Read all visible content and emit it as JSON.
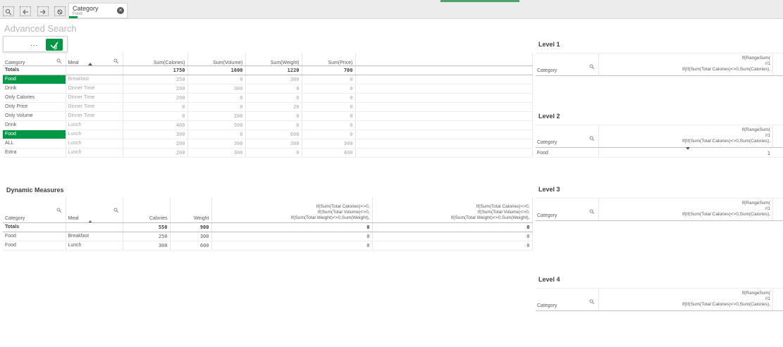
{
  "toolbar": {
    "tools": [
      "smart-search-icon",
      "step-back-icon",
      "step-forward-icon",
      "clear-selections-icon"
    ],
    "selection_chip": {
      "field": "Category",
      "value": "Food"
    }
  },
  "sheet_title": "Advanced Search",
  "search_popup": {
    "dots": "..."
  },
  "main_table": {
    "headers": [
      "Category",
      "Meal",
      "Sum(Calories)",
      "Sum(Volume)",
      "Sum(Weight)",
      "Sum(Price)"
    ],
    "totals": [
      "Totals",
      "",
      "1750",
      "1600",
      "1220",
      "700"
    ],
    "rows": [
      [
        "Food",
        "Breakfast",
        "250",
        "0",
        "300",
        "0"
      ],
      [
        "Drink",
        "Dinner Time",
        "200",
        "300",
        "0",
        "0"
      ],
      [
        "Only Calories",
        "Dinner Time",
        "200",
        "0",
        "0",
        "0"
      ],
      [
        "Only Price",
        "Dinner Time",
        "0",
        "0",
        "20",
        "0"
      ],
      [
        "Only Volume",
        "Dinner Time",
        "0",
        "200",
        "0",
        "0"
      ],
      [
        "Drink",
        "Lunch",
        "400",
        "500",
        "0",
        "0"
      ],
      [
        "Food",
        "Lunch",
        "300",
        "0",
        "600",
        "0"
      ],
      [
        "ALL",
        "Lunch",
        "200",
        "300",
        "300",
        "300"
      ],
      [
        "Extra",
        "Lunch",
        "200",
        "300",
        "0",
        "400"
      ]
    ]
  },
  "dynamic_measures": {
    "title": "Dynamic Measures",
    "headers": [
      "Category",
      "Meal",
      "Calories",
      "Weight"
    ],
    "expr_col1": [
      "If(Sum(Total Calories)<>0,",
      "If(Sum(Total Volume)<>0,",
      "If(Sum(Total Weight)<>0,Sum(Weight),"
    ],
    "expr_col2": [
      "If(Sum(Total Calories)<>0,",
      "If(Sum(Total Volume)<>0,",
      "If(Sum(Total Weight)<>0,Sum(Weight),"
    ],
    "totals": [
      "Totals",
      "",
      "550",
      "900",
      "0",
      "0"
    ],
    "rows": [
      [
        "Food",
        "Breakfast",
        "250",
        "300",
        "0",
        "0"
      ],
      [
        "Food",
        "Lunch",
        "300",
        "600",
        "0",
        "0"
      ]
    ]
  },
  "levels": [
    {
      "title": "Level 1",
      "category": "Category",
      "expr": [
        "If(RangeSum(",
        "//1",
        "If(If(Sum(Total Calories)<>0,Sum(Calories),"
      ],
      "rows": []
    },
    {
      "title": "Level 2",
      "category": "Category",
      "expr": [
        "If(RangeSum(",
        "//1",
        "If(If(Sum(Total Calories)<>0,Sum(Calories),"
      ],
      "rows": [
        [
          "Food",
          "1"
        ]
      ]
    },
    {
      "title": "Level 3",
      "category": "Category",
      "expr": [
        "If(RangeSum(",
        "//1",
        "If(If(Sum(Total Calories)<>0,Sum(Calories),"
      ],
      "rows": []
    },
    {
      "title": "Level 4",
      "category": "Category",
      "expr": [
        "If(RangeSum(",
        "//1",
        "If(If(Sum(Total Calories)<>0,Sum(Calories),"
      ],
      "rows": []
    }
  ],
  "colors": {
    "accent": "#009845",
    "header_bg": "#ececec"
  }
}
